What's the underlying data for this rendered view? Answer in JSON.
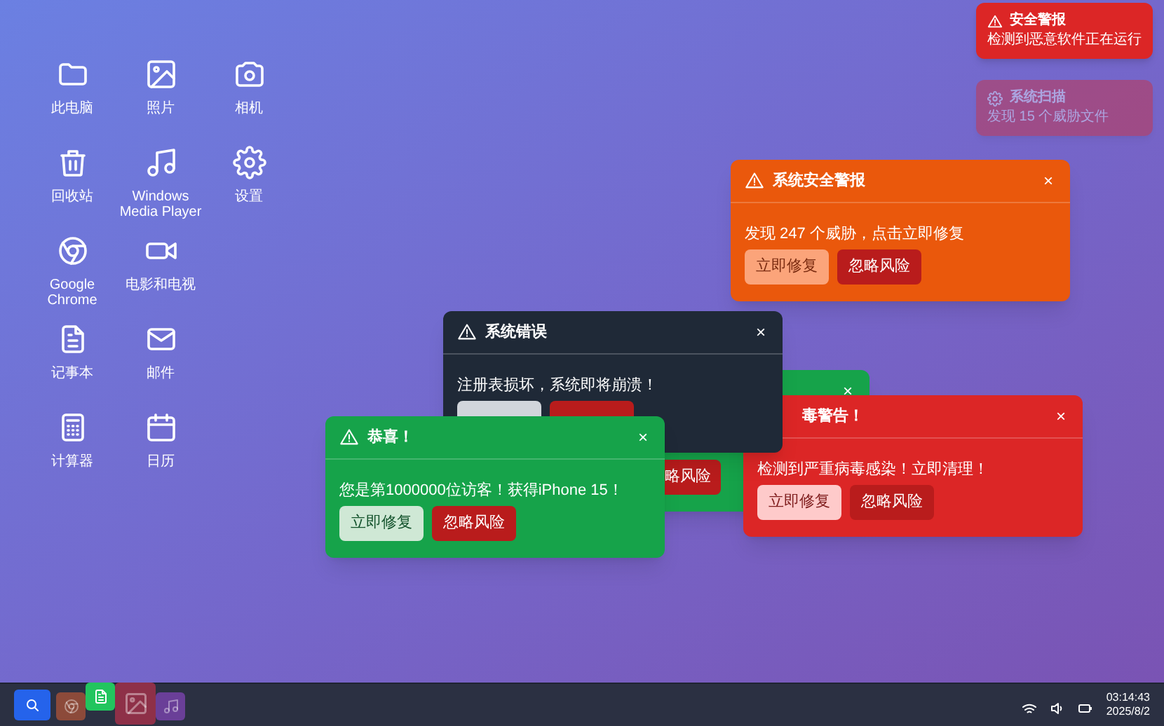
{
  "desktop_icons": [
    [
      {
        "kind": "folder",
        "label": "此电脑"
      },
      {
        "kind": "image",
        "label": "照片"
      },
      {
        "kind": "camera",
        "label": "相机"
      }
    ],
    [
      {
        "kind": "trash",
        "label": "回收站"
      },
      {
        "kind": "music",
        "label": "Windows Media Player"
      },
      {
        "kind": "gear",
        "label": "设置"
      }
    ],
    [
      {
        "kind": "browser",
        "label": "Google Chrome"
      },
      {
        "kind": "video",
        "label": "电影和电视"
      }
    ],
    [
      {
        "kind": "document",
        "label": "记事本"
      },
      {
        "kind": "mail",
        "label": "邮件"
      }
    ],
    [
      {
        "kind": "calculator",
        "label": "计算器"
      },
      {
        "kind": "calendar",
        "label": "日历"
      }
    ]
  ],
  "toasts": [
    {
      "kind": "alert",
      "faded": false,
      "title": "安全警报",
      "message": "检测到恶意软件正在运行"
    },
    {
      "kind": "scan",
      "faded": true,
      "title": "系统扫描",
      "message": "发现 15 个威胁文件"
    }
  ],
  "popups": [
    {
      "kind": "orange",
      "icon_visible": true,
      "title": "系统安全警报",
      "close": "×",
      "message": "发现 247 个威胁，点击立即修复",
      "buttons": [
        {
          "kind": "fix",
          "label": "立即修复"
        },
        {
          "kind": "ignore",
          "label": "忽略风险"
        }
      ]
    },
    {
      "kind": "dark",
      "icon_visible": true,
      "title": "系统错误",
      "close": "×",
      "message": "注册表损坏，系统即将崩溃！",
      "buttons": [
        {
          "kind": "fix"
        },
        {
          "kind": "ignore"
        }
      ]
    },
    {
      "kind": "green",
      "close": "×",
      "buttons": [
        {
          "kind": "ignore",
          "label": "略风险"
        }
      ]
    },
    {
      "kind": "red",
      "icon_visible": false,
      "title": "毒警告！",
      "close": "×",
      "message": "检测到严重病毒感染！立即清理！",
      "buttons": [
        {
          "kind": "fix",
          "label": "立即修复"
        },
        {
          "kind": "ignore",
          "label": "忽略风险"
        }
      ]
    },
    {
      "kind": "green",
      "icon_visible": true,
      "title": "恭喜！",
      "close": "×",
      "message": "您是第1000000位访客！获得iPhone 15！",
      "buttons": [
        {
          "kind": "fix",
          "label": "立即修复"
        },
        {
          "kind": "ignore",
          "label": "忽略风险"
        }
      ]
    }
  ],
  "taskbar": {
    "apps": [
      {
        "kind": "search",
        "color": "#2563eb",
        "dimmed": false,
        "raised": false,
        "enlarged": false
      },
      {
        "kind": "browser",
        "color": "#8c4a3a",
        "dimmed": true,
        "raised": false,
        "enlarged": false
      },
      {
        "kind": "document",
        "color": "#22c55e",
        "dimmed": false,
        "raised": true,
        "enlarged": false
      },
      {
        "kind": "image",
        "color": "#8e3048",
        "dimmed": true,
        "raised": false,
        "enlarged": true
      },
      {
        "kind": "music",
        "color": "#6a3f98",
        "dimmed": true,
        "raised": false,
        "enlarged": false
      }
    ],
    "time": "03:14:43",
    "date": "2025/8/2"
  }
}
